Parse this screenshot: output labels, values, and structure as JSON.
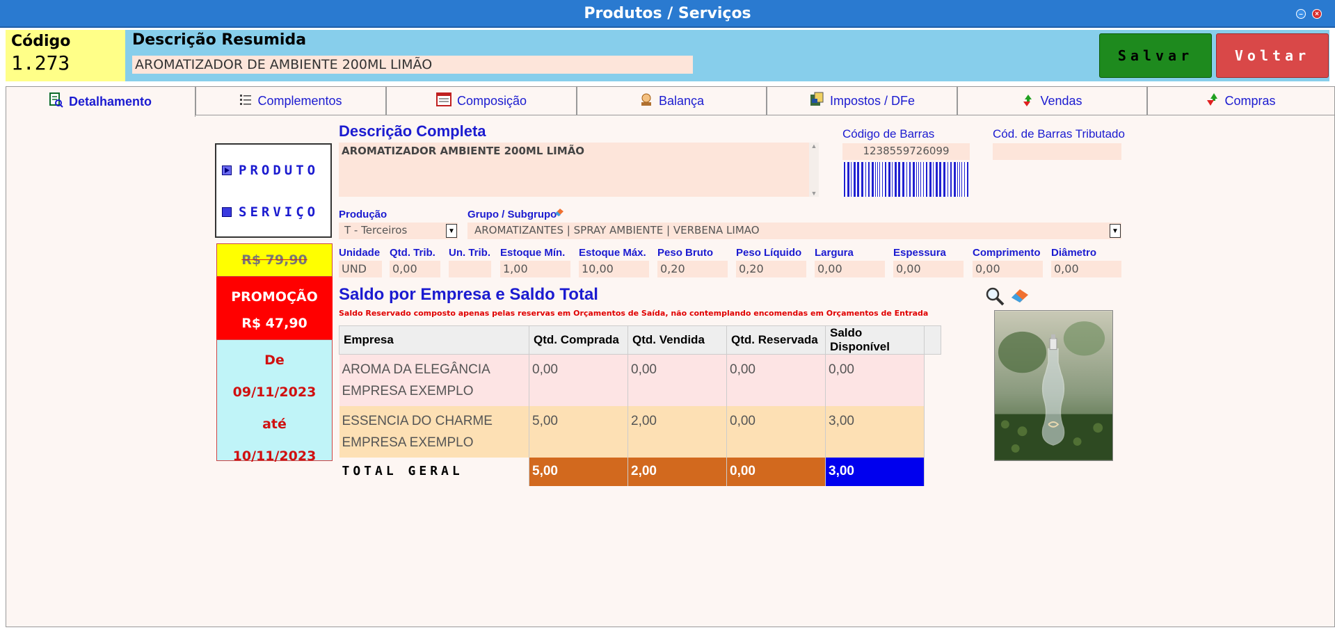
{
  "window": {
    "title": "Produtos / Serviços"
  },
  "header": {
    "code_label": "Código",
    "code_value": "1.273",
    "short_desc_label": "Descrição Resumida",
    "short_desc_value": "AROMATIZADOR DE AMBIENTE 200ML LIMÃO",
    "save_label": "Salvar",
    "back_label": "Voltar"
  },
  "tabs": [
    {
      "label": "Detalhamento",
      "icon": "detail-icon"
    },
    {
      "label": "Complementos",
      "icon": "list-icon"
    },
    {
      "label": "Composição",
      "icon": "composition-icon"
    },
    {
      "label": "Balança",
      "icon": "scale-icon"
    },
    {
      "label": "Impostos / DFe",
      "icon": "tax-icon"
    },
    {
      "label": "Vendas",
      "icon": "sales-arrows-icon"
    },
    {
      "label": "Compras",
      "icon": "purchases-arrows-icon"
    }
  ],
  "type": {
    "produto": "PRODUTO",
    "servico": "SERVIÇO",
    "selected": "PRODUTO"
  },
  "price": {
    "old": "R$ 79,90",
    "promo_label": "PROMOÇÃO",
    "promo_value": "R$ 47,90",
    "from_label": "De",
    "from_date": "09/11/2023",
    "to_label": "até",
    "to_date": "10/11/2023"
  },
  "details": {
    "full_desc_label": "Descrição Completa",
    "full_desc_value": "AROMATIZADOR AMBIENTE 200ML LIMÃO",
    "barcode_label": "Código de Barras",
    "barcode_value": "1238559726099",
    "taxed_barcode_label": "Cód. de Barras Tributado",
    "taxed_barcode_value": "",
    "production_label": "Produção",
    "production_value": "T - Terceiros",
    "group_label": "Grupo / Subgrupo",
    "group_value": "AROMATIZANTES | SPRAY AMBIENTE | VERBENA LIMAO"
  },
  "specs": [
    {
      "label": "Unidade",
      "value": "UND"
    },
    {
      "label": "Qtd. Trib.",
      "value": "0,00"
    },
    {
      "label": "Un. Trib.",
      "value": ""
    },
    {
      "label": "Estoque Mín.",
      "value": "1,00"
    },
    {
      "label": "Estoque Máx.",
      "value": "10,00"
    },
    {
      "label": "Peso Bruto",
      "value": "0,20"
    },
    {
      "label": "Peso Líquido",
      "value": "0,20"
    },
    {
      "label": "Largura",
      "value": "0,00"
    },
    {
      "label": "Espessura",
      "value": "0,00"
    },
    {
      "label": "Comprimento",
      "value": "0,00"
    },
    {
      "label": "Diâmetro",
      "value": "0,00"
    }
  ],
  "stock": {
    "title": "Saldo por Empresa e Saldo Total",
    "note": "Saldo Reservado composto apenas pelas reservas em Orçamentos de Saída, não contemplando encomendas em Orçamentos de Entrada",
    "headers": [
      "Empresa",
      "Qtd. Comprada",
      "Qtd. Vendida",
      "Qtd. Reservada",
      "Saldo Disponível"
    ],
    "rows": [
      [
        "AROMA DA ELEGÂNCIA EMPRESA EXEMPLO",
        "0,00",
        "0,00",
        "0,00",
        "0,00"
      ],
      [
        "ESSENCIA DO CHARME EMPRESA EXEMPLO",
        "5,00",
        "2,00",
        "0,00",
        "3,00"
      ]
    ],
    "total": [
      "TOTAL GERAL",
      "5,00",
      "2,00",
      "0,00",
      "3,00"
    ]
  },
  "colors": {
    "titlebar": "#2a7ad0",
    "accent_text": "#1b1bd0",
    "save": "#1e8a1e",
    "back": "#d94848",
    "total_orange": "#d2691e",
    "total_blue": "#0000ee"
  }
}
